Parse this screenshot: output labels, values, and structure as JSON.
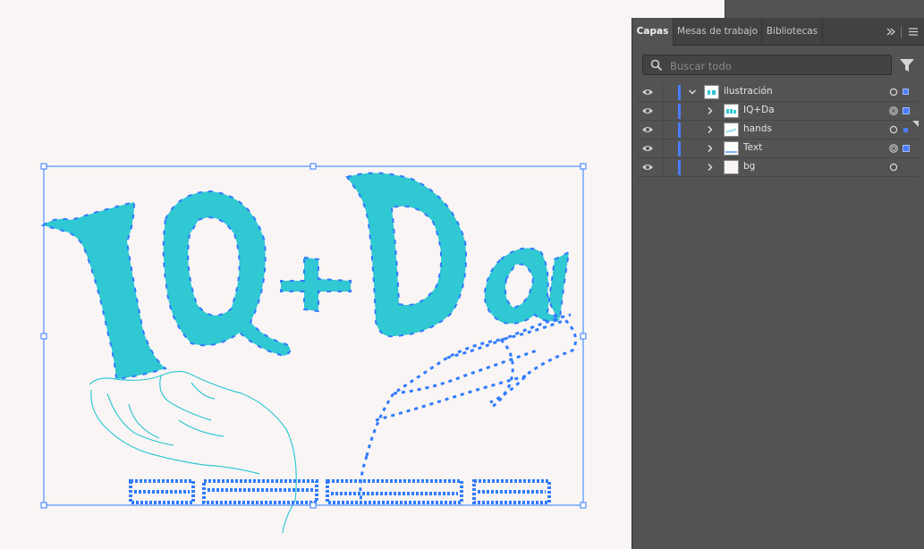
{
  "panel": {
    "tabs": [
      {
        "label": "Capas",
        "active": true
      },
      {
        "label": "Mesas de trabajo",
        "active": false
      },
      {
        "label": "Bibliotecas",
        "active": false
      }
    ],
    "collapse_icon": "double-chevron-right-icon",
    "menu_icon": "hamburger-menu-icon"
  },
  "search": {
    "placeholder": "Buscar todo",
    "value": ""
  },
  "layers": [
    {
      "name": "ilustración",
      "level": 0,
      "expanded": true,
      "color": "#4a7cff",
      "target": "single",
      "selected_box": true
    },
    {
      "name": "IQ+Da",
      "level": 1,
      "expanded": false,
      "color": "#4a7cff",
      "target": "double",
      "selected_box": true
    },
    {
      "name": "hands",
      "level": 1,
      "expanded": false,
      "color": "#4a7cff",
      "target": "single",
      "selected_box": true
    },
    {
      "name": "Text",
      "level": 1,
      "expanded": false,
      "color": "#4a7cff",
      "target": "double",
      "selected_box": true
    },
    {
      "name": "bg",
      "level": 1,
      "expanded": false,
      "color": "#4a7cff",
      "target": "single",
      "selected_box": false
    }
  ],
  "colors": {
    "panel_bg": "#535353",
    "tab_bar_bg": "#424242",
    "selection_blue": "#2f7bff",
    "artwork_teal": "#30c8d2",
    "canvas_bg": "#faf5f5"
  },
  "artwork": {
    "headline": "IQ+Da",
    "footer_text_icon": "outlined-text-path"
  }
}
